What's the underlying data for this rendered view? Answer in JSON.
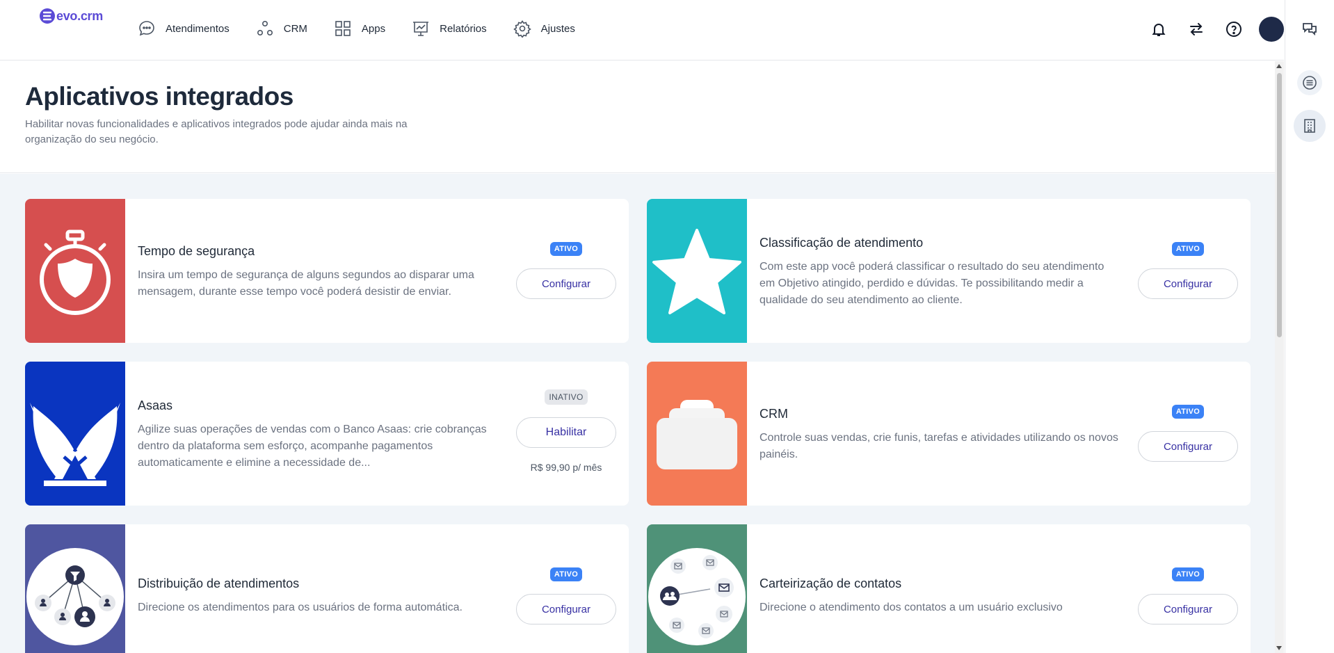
{
  "brand": {
    "name": "evo.crm",
    "color": "#5b4bd6"
  },
  "nav": [
    {
      "label": "Atendimentos",
      "icon": "chat-bubble-icon"
    },
    {
      "label": "CRM",
      "icon": "nodes-icon"
    },
    {
      "label": "Apps",
      "icon": "grid-icon"
    },
    {
      "label": "Relatórios",
      "icon": "presentation-chart-icon"
    },
    {
      "label": "Ajustes",
      "icon": "gear-icon"
    }
  ],
  "top_actions": [
    "bell-icon",
    "arrows-swap-icon",
    "help-circle-icon",
    "avatar"
  ],
  "right_rail": [
    "chat-bubbles-icon",
    "menu-lines-icon",
    "building-icon"
  ],
  "page": {
    "title": "Aplicativos integrados",
    "subtitle": "Habilitar novas funcionalidades e aplicativos integrados pode ajudar ainda mais na organização do seu negócio."
  },
  "apps": [
    {
      "title": "Tempo de segurança",
      "description": "Insira um tempo de segurança de alguns segundos ao disparar uma mensagem, durante esse tempo você poderá desistir de enviar.",
      "status": "ATIVO",
      "action": "Configurar",
      "thumb_color": "#d64f4f",
      "icon": "stopwatch-shield-icon"
    },
    {
      "title": "Classificação de atendimento",
      "description": "Com este app você poderá classificar o resultado do seu atendimento em Objetivo atingido, perdido e dúvidas. Te possibilitando medir a qualidade do seu atendimento ao cliente.",
      "status": "ATIVO",
      "action": "Configurar",
      "thumb_color": "#1fbfc8",
      "icon": "star-icon"
    },
    {
      "title": "Asaas",
      "description": "Agilize suas operações de vendas com o Banco Asaas: crie cobranças dentro da plataforma sem esforço, acompanhe pagamentos automaticamente e elimine a necessidade de...",
      "status": "INATIVO",
      "action": "Habilitar",
      "price": "R$ 99,90 p/ mês",
      "thumb_color": "#0a35c0",
      "icon": "wings-icon"
    },
    {
      "title": "CRM",
      "description": "Controle suas vendas, crie funis, tarefas e atividades utilizando os novos painéis.",
      "status": "ATIVO",
      "action": "Configurar",
      "thumb_color": "#f47a56",
      "icon": "stacked-cards-icon"
    },
    {
      "title": "Distribuição de atendimentos",
      "description": "Direcione os atendimentos para os usuários de forma automática.",
      "status": "ATIVO",
      "action": "Configurar",
      "thumb_color": "#4f56a0",
      "icon": "distribution-network-icon"
    },
    {
      "title": "Carteirização de contatos",
      "description": "Direcione o atendimento dos contatos a um usuário exclusivo",
      "status": "ATIVO",
      "action": "Configurar",
      "thumb_color": "#4f9278",
      "icon": "contacts-network-icon"
    }
  ]
}
